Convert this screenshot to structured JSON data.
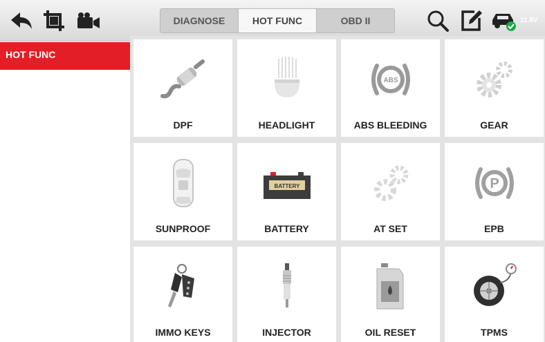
{
  "tabs": [
    {
      "label": "DIAGNOSE",
      "active": false
    },
    {
      "label": "HOT FUNC",
      "active": true
    },
    {
      "label": "OBD II",
      "active": false
    }
  ],
  "status": {
    "voltage": "11.8V"
  },
  "sidebar": {
    "items": [
      {
        "label": "HOT FUNC",
        "selected": true
      }
    ]
  },
  "functions": [
    {
      "label": "DPF",
      "icon": "dpf-icon"
    },
    {
      "label": "HEADLIGHT",
      "icon": "headlight-icon"
    },
    {
      "label": "ABS BLEEDING",
      "icon": "abs-icon"
    },
    {
      "label": "GEAR",
      "icon": "gear-icon"
    },
    {
      "label": "SUNPROOF",
      "icon": "sunroof-car-icon"
    },
    {
      "label": "BATTERY",
      "icon": "battery-icon",
      "text": "BATTERY"
    },
    {
      "label": "AT SET",
      "icon": "at-gears-icon"
    },
    {
      "label": "EPB",
      "icon": "parking-brake-icon",
      "text": "P"
    },
    {
      "label": "IMMO KEYS",
      "icon": "car-keys-icon"
    },
    {
      "label": "INJECTOR",
      "icon": "injector-icon"
    },
    {
      "label": "OIL RESET",
      "icon": "oil-can-icon"
    },
    {
      "label": "TPMS",
      "icon": "tire-gauge-icon"
    }
  ],
  "colors": {
    "accent": "#e41e26",
    "status_ok": "#1fa64a"
  }
}
